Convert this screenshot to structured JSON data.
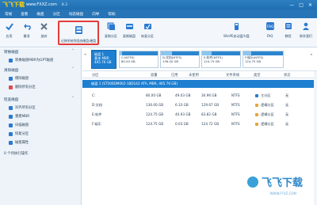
{
  "title_bar": {
    "logo_main": "飞飞下载",
    "logo_url": "www.FXXZ.com",
    "version": "8.3"
  },
  "menu": [
    "常规",
    "查看",
    "磁盘",
    "分区",
    "动态磁盘",
    "向导",
    "帮助"
  ],
  "toolbar": {
    "apply": "应用",
    "undo": "撤消",
    "discard": "放弃",
    "migrate": "迁移系统到固态硬盘/硬盘",
    "copy_partition": "复制分区",
    "copy_disk": "复制磁盘",
    "recover_partition": "恢复分区",
    "wizard": "WinPE启动盘/U盘",
    "faq": "FAQ",
    "tutorial": "教程",
    "upgrade": "联系我们"
  },
  "sidebar": {
    "sections": [
      {
        "title": "转换磁盘",
        "items": [
          "转换磁盘MBR为GPT磁盘"
        ]
      },
      {
        "title": "清除磁盘",
        "items": [
          "擦除磁盘",
          "删除所有分区"
        ]
      },
      {
        "title": "检查磁盘",
        "items": [
          "对齐所有分区",
          "重建MBR",
          "扫描磁盘",
          "恢复分区",
          "磁盘属性"
        ]
      }
    ],
    "pending": "0 个待执行操作"
  },
  "diskmap": {
    "disk": {
      "name": "磁盘 1",
      "type": "基本 MBR",
      "size": "465.76 GB"
    },
    "partitions": [
      {
        "label": "C:(NTFS)",
        "size": "80.00 GB",
        "fill": 0.06
      },
      {
        "label": "D:文档(NTFS)",
        "size": "136.00 GB",
        "fill": 0.3
      },
      {
        "label": "E:软件(NTFS)",
        "size": "124.75 GB",
        "fill": 0.25
      },
      {
        "label": "F:娱乐(NTFS)",
        "size": "124.75 GB",
        "fill": 0.2
      }
    ]
  },
  "table": {
    "headers": [
      "分区",
      "容量",
      "已用",
      "未使用",
      "文件系统",
      "类型",
      "状态"
    ],
    "disk_row": "磁盘 1 (ST500DM002-1BD142 ATA, MBR, 465.76 GB)",
    "rows": [
      {
        "name": "C:",
        "capacity": "80.00 GB",
        "used": "49.03 GB",
        "free": "30.96 GB",
        "fs": "NTFS",
        "type": "主分区",
        "status": "无"
      },
      {
        "name": "D:文档",
        "capacity": "136.00 GB",
        "used": "6.33 GB",
        "free": "129.67 GB",
        "fs": "NTFS",
        "type": "逻辑分区",
        "status": "无"
      },
      {
        "name": "E:软件",
        "capacity": "124.75 GB",
        "used": "40.93 GB",
        "free": "83.82 GB",
        "fs": "NTFS",
        "type": "逻辑分区",
        "status": "无"
      },
      {
        "name": "F:娱乐",
        "capacity": "124.75 GB",
        "used": "0.03 GB",
        "free": "124.72 GB",
        "fs": "NTFS",
        "type": "逻辑分区",
        "status": "无"
      }
    ]
  },
  "watermark": {
    "text": "飞飞下载",
    "url": "WWW.FFXZ.COM"
  },
  "colors": {
    "accent": "#1e7fd0",
    "highlight": "#e43b3b"
  }
}
